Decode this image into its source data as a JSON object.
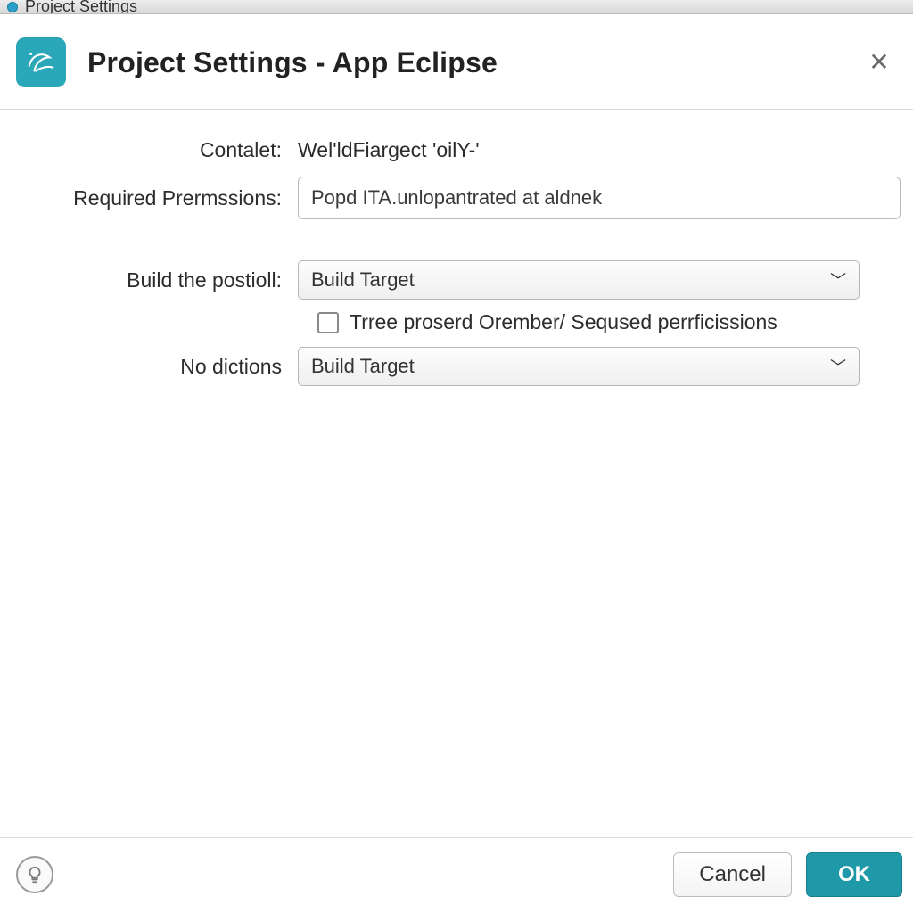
{
  "window": {
    "titlebar_text": "Project Settings"
  },
  "header": {
    "title": "Project Settings - App Eclipse"
  },
  "form": {
    "contact_label": "Contalet:",
    "contact_value": "Wel'ldFiargect 'oilY-'",
    "permissions_label": "Required Prermssions:",
    "permissions_value": "Popd ITA.unlopantrated at aldnek",
    "build_label": "Build the postioll:",
    "build_select": "Build Target",
    "checkbox_label": "Trree proserd Orember/ Seqused perrficissions",
    "checkbox_checked": false,
    "nodict_label": "No dictions",
    "nodict_select": "Build Target"
  },
  "footer": {
    "cancel": "Cancel",
    "ok": "OK"
  },
  "colors": {
    "accent": "#1f98a8"
  }
}
